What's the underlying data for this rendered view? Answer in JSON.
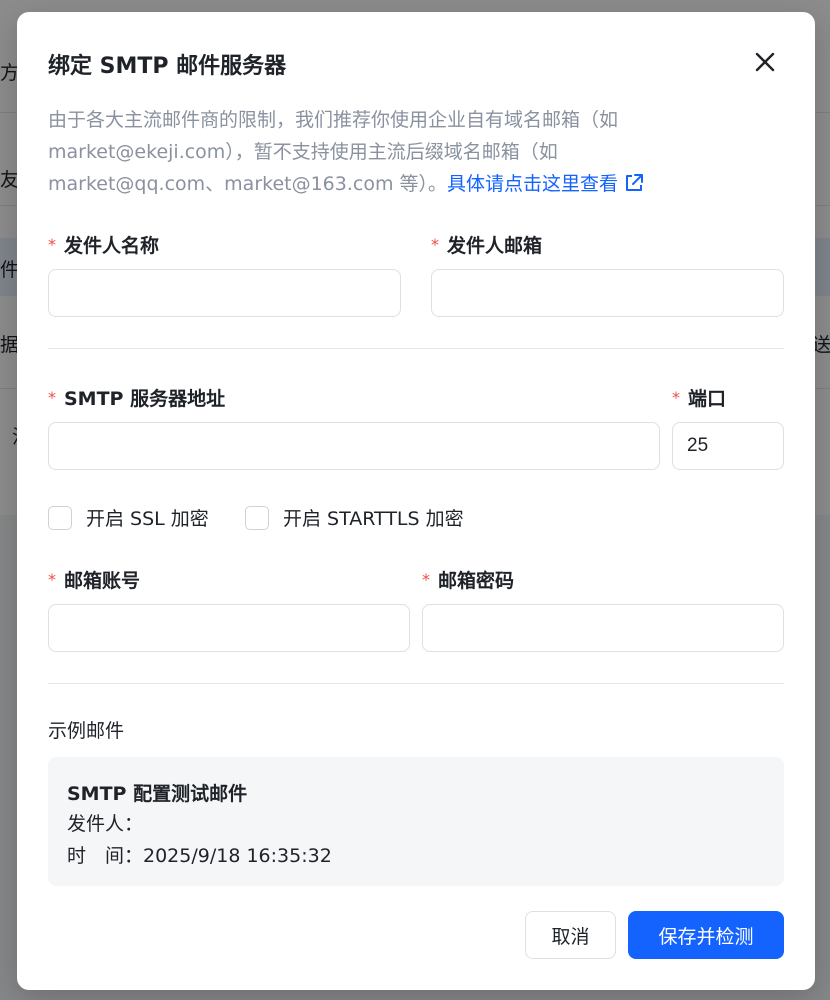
{
  "background": {
    "fragments": [
      "方",
      "友",
      "件",
      "据",
      "注",
      "送"
    ]
  },
  "dialog": {
    "title": "绑定 SMTP 邮件服务器",
    "description": "由于各大主流邮件商的限制，我们推荐你使用企业自有域名邮箱（如 market@ekeji.com），暂不支持使用主流后缀域名邮箱（如 market@qq.com、market@163.com 等）。",
    "description_link": "具体请点击这里查看",
    "required_mark": "*",
    "sender_name_label": "发件人名称",
    "sender_name_value": "",
    "sender_email_label": "发件人邮箱",
    "sender_email_value": "",
    "smtp_address_label": "SMTP 服务器地址",
    "smtp_address_value": "",
    "port_label": "端口",
    "port_value": "25",
    "ssl_label": "开启 SSL 加密",
    "starttls_label": "开启 STARTTLS 加密",
    "account_label": "邮箱账号",
    "account_value": "",
    "password_label": "邮箱密码",
    "password_value": "",
    "sample_section_title": "示例邮件",
    "sample": {
      "title": "SMTP 配置测试邮件",
      "sender_line": "发件人：",
      "time_line": "时　间：2025/9/18 16:35:32"
    },
    "cancel_label": "取消",
    "save_label": "保存并检测"
  },
  "colors": {
    "primary": "#1463ff",
    "required": "#f54a45",
    "muted_text": "#8a919f"
  }
}
